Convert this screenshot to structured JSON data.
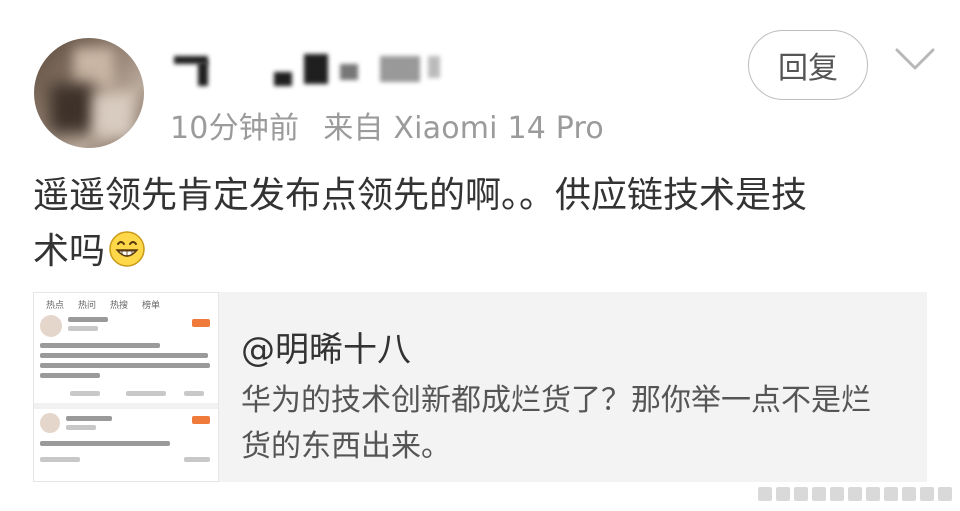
{
  "post": {
    "time": "10分钟前",
    "source": "来自 Xiaomi 14 Pro",
    "content_line1": "遥遥领先肯定发布点领先的啊。。供应链技术是技",
    "content_line2": "术吗",
    "emoji_icon": "grin-emoji-icon"
  },
  "actions": {
    "reply_label": "回复",
    "more_icon": "chevron-down-icon"
  },
  "quote": {
    "author": "@明晞十八",
    "text_line1": "华为的技术创新都成烂货了？那你举一点不是烂",
    "text_line2": "货的东西出来。",
    "thumbnail_tabs": [
      "热点",
      "热问",
      "热搜",
      "榜单"
    ]
  },
  "colors": {
    "meta_gray": "#9b9b9b",
    "text": "#333333",
    "quote_bg": "#f3f3f3",
    "border": "#bdbdbd"
  }
}
